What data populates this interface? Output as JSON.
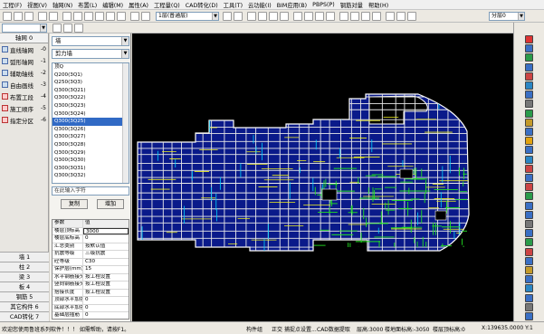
{
  "menu": [
    {
      "label": "工程(F)"
    },
    {
      "label": "视图(V)"
    },
    {
      "label": "轴网(N)"
    },
    {
      "label": "布置(L)"
    },
    {
      "label": "编辑(M)"
    },
    {
      "label": "属性(A)"
    },
    {
      "label": "工程量(Q)"
    },
    {
      "label": "CAD转化(D)"
    },
    {
      "label": "工具(T)"
    },
    {
      "label": "云功能(I)"
    },
    {
      "label": "BIM应用(B)"
    },
    {
      "label": "PBPS(P)"
    },
    {
      "label": "钢筋对量"
    },
    {
      "label": "帮助(H)"
    }
  ],
  "toolbar": {
    "floor_select": "1层(普通层)",
    "view_select": "分层0"
  },
  "left_panel": {
    "header": "轴网 0",
    "items": [
      {
        "label": "直线轴网",
        "key": "-0",
        "icon": "straight-axis-icon"
      },
      {
        "label": "弧形轴网",
        "key": "-1",
        "icon": "arc-axis-icon"
      },
      {
        "label": "辅助轴线",
        "key": "-2",
        "icon": "aux-axis-icon"
      },
      {
        "label": "自由画线",
        "key": "-3",
        "icon": "free-line-icon"
      },
      {
        "label": "布置工段",
        "key": "-4",
        "icon": "layout-section-icon"
      },
      {
        "label": "施工顺序",
        "key": "-5",
        "icon": "construction-order-icon"
      },
      {
        "label": "指定分区",
        "key": "-6",
        "icon": "assign-zone-icon"
      }
    ],
    "tabs": [
      {
        "label": "墙 1"
      },
      {
        "label": "柱 2"
      },
      {
        "label": "梁 3"
      },
      {
        "label": "板 4"
      },
      {
        "label": "钢筋 5"
      },
      {
        "label": "其它构件 6"
      },
      {
        "label": "CAD转化 7"
      }
    ]
  },
  "component_panel": {
    "category": "墙",
    "subcategory": "剪力墙",
    "list": [
      "顶Q",
      "Q200(3Q1)",
      "Q250(3Q3)",
      "Q300(3Q21)",
      "Q300(3Q22)",
      "Q300(3Q23)",
      "Q300(3Q24)",
      "Q300(3Q25)",
      "Q300(3Q26)",
      "Q300(3Q27)",
      "Q300(3Q28)",
      "Q300(3Q29)",
      "Q300(3Q30)",
      "Q300(3Q31)",
      "Q300(3Q32)"
    ],
    "selected_index": 7,
    "search_placeholder": "在此输入字符",
    "copy_button": "复制",
    "add_button": "增加"
  },
  "properties": {
    "header": [
      "参数",
      "值"
    ],
    "rows": [
      [
        "楼层顶标高",
        "3000"
      ],
      [
        "楼层底标高",
        "0"
      ],
      [
        "汇总类别",
        "按默认值"
      ],
      [
        "抗震等级",
        "三级抗震"
      ],
      [
        "砼等级",
        "C30"
      ],
      [
        "保护层(mm)",
        "15"
      ],
      [
        "水平钢筋接头",
        "按工程设置"
      ],
      [
        "竖向钢筋接头",
        "按工程设置"
      ],
      [
        "搭接长度",
        "按工程设置"
      ],
      [
        "顶部水平加强",
        "0"
      ],
      [
        "底部水平加强",
        "0"
      ],
      [
        "基础层插筋",
        "0"
      ],
      [
        "墙底加强筋长",
        "0"
      ],
      [
        "墙面钢筋网片",
        "按上取整"
      ]
    ]
  },
  "status_bar": {
    "message": "欢迎您使用鲁班系列软件！！！  如需帮助，请按F1。",
    "items": [
      "构件组",
      "正交",
      "捕捉点设置...",
      "CAD数据提取",
      "层高:3000",
      "楼地面标高:-3050",
      "楼层顶标高:0"
    ],
    "coordinates": "X:139635.0000 Y:1"
  },
  "colors": {
    "canvas_bg": "#000000",
    "floor_fill": "#0a1a8a",
    "outline": "#ffffff",
    "rebar": "#22e022",
    "beam": "#f0f020"
  }
}
